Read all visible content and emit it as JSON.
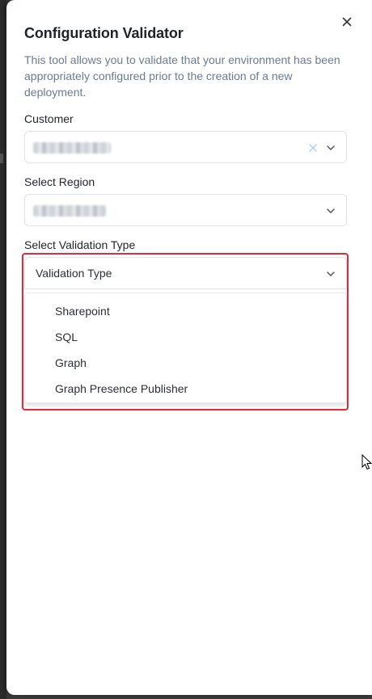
{
  "panel": {
    "title": "Configuration Validator",
    "description": "This tool allows you to validate that your environment has been appropriately configured prior to the creation of a new deployment."
  },
  "customer": {
    "label": "Customer"
  },
  "region": {
    "label": "Select Region"
  },
  "validation": {
    "label": "Select Validation Type",
    "placeholder": "Validation Type",
    "options": [
      "Sharepoint",
      "SQL",
      "Graph",
      "Graph Presence Publisher"
    ]
  },
  "colors": {
    "highlight": "#e02b3a",
    "description_text": "#6b7b8f",
    "clear_icon": "#a8d4ee"
  }
}
